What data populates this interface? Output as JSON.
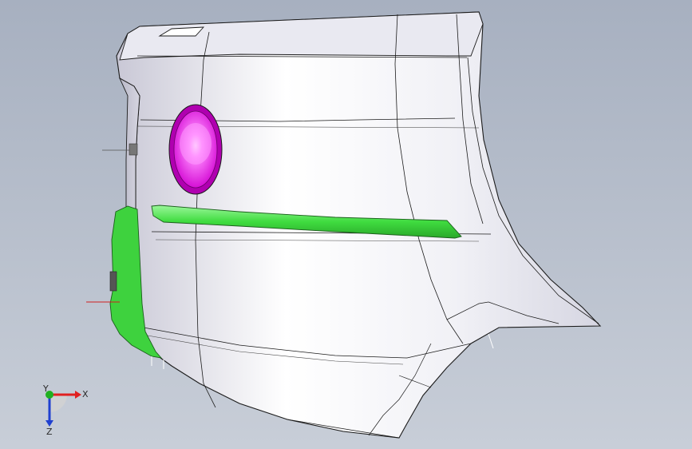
{
  "viewport": {
    "background_top": "#a7b0c0",
    "background_bottom": "#c8ced8"
  },
  "model": {
    "body_color": "#f4f4f8",
    "edge_color": "#1b1b1b",
    "port_color": "#e400e4",
    "strip_color": "#45e045",
    "bracket_color": "#3ed23e"
  },
  "triad": {
    "x_label": "X",
    "y_label": "Y",
    "z_label": "Z",
    "x_color": "#e02020",
    "y_color": "#20b020",
    "z_color": "#2040d0"
  }
}
